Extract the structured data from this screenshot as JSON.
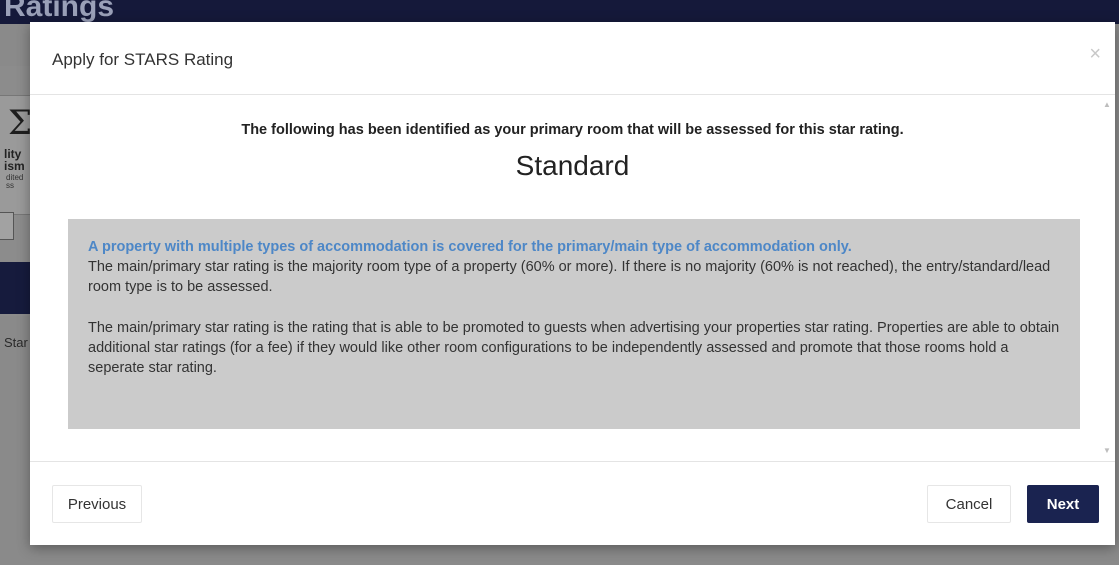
{
  "background": {
    "header_title": "Ratings",
    "logo_mark": "Σ",
    "logo_text_line1": "lity",
    "logo_text_line2": "ism",
    "logo_text_small1": "dited",
    "logo_text_small2": "ss",
    "star_label": "Star"
  },
  "modal": {
    "title": "Apply for STARS Rating",
    "close_glyph": "×",
    "intro": "The following has been identified as your primary room that will be assessed for this star rating.",
    "room_type": "Standard",
    "info": {
      "lead": "A property with multiple types of accommodation is covered for the primary/main type of accommodation only.",
      "paragraph1": "The main/primary star rating is the majority room type of a property (60% or more). If there is no majority (60% is not reached), the entry/standard/lead room type is to be assessed.",
      "paragraph2": "The main/primary star rating is the rating that is able to be promoted to guests when advertising your properties star rating. Properties are able to obtain additional star ratings (for a fee) if they would like other room configurations to be independently assessed and promote that those rooms hold a seperate star rating."
    },
    "scroll_up_glyph": "▲",
    "scroll_down_glyph": "▼",
    "footer": {
      "previous_label": "Previous",
      "cancel_label": "Cancel",
      "next_label": "Next"
    }
  },
  "colors": {
    "header_bg": "#15193a",
    "primary_button": "#1a2350",
    "info_lead": "#4d87c7",
    "info_box_bg": "#cbcbcb",
    "overlay": "#8a8a8a"
  }
}
